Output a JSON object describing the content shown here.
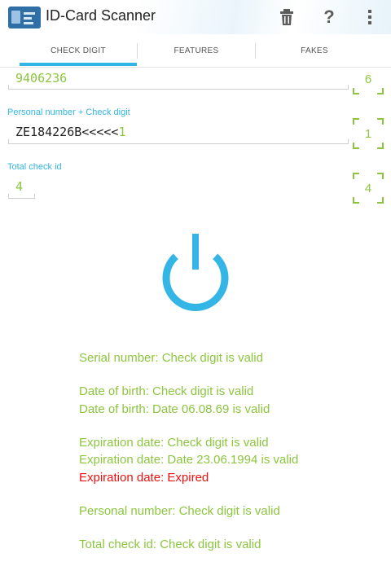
{
  "app": {
    "title": "ID-Card Scanner"
  },
  "actions": {
    "delete_icon": "trash-icon",
    "help_label": "?",
    "overflow_icon": "overflow-menu-icon"
  },
  "tabs": [
    {
      "label": "CHECK DIGIT",
      "selected": true
    },
    {
      "label": "FEATURES",
      "selected": false
    },
    {
      "label": "FAKES",
      "selected": false
    }
  ],
  "fields": {
    "serial": {
      "value": "9406236",
      "check": "6"
    },
    "personal": {
      "label": "Personal number + Check digit",
      "value": "ZE184226B<<<<<",
      "value_check": "1",
      "check": "1"
    },
    "total": {
      "label": "Total check id",
      "value": "4",
      "check": "4"
    }
  },
  "results": {
    "r1": "Serial number: Check digit is valid",
    "r2": "Date of birth: Check digit is valid",
    "r3": "Date of birth: Date 06.08.69 is valid",
    "r4": "Expiration date: Check digit is valid",
    "r5": "Expiration date: Date 23.06.1994 is valid",
    "r6": "Expiration date: Expired",
    "r7": "Personal number: Check digit is valid",
    "r8": "Total check id: Check digit is valid"
  },
  "colors": {
    "accent": "#33b5e5",
    "valid": "#8cc63f",
    "error": "#ee1111"
  }
}
